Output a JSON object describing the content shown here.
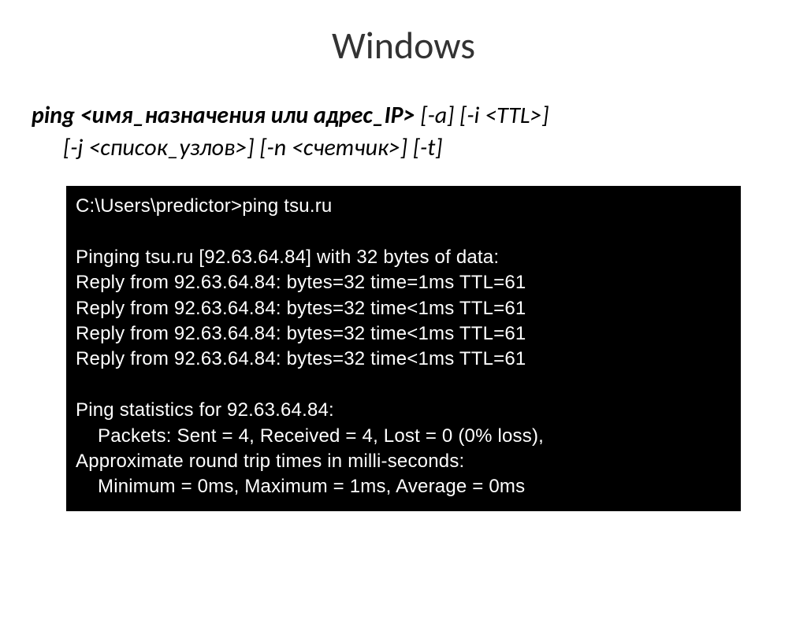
{
  "title": "Windows",
  "syntax": {
    "line1_bold": "ping <имя_назначения или адрес_IP>",
    "line1_rest": " [-a] [-i <TTL>]",
    "line2": "[-j <список_узлов>] [-n <счетчик>] [-t]"
  },
  "terminal": {
    "prompt": "C:\\Users\\predictor>ping tsu.ru",
    "header": "Pinging tsu.ru [92.63.64.84] with 32 bytes of data:",
    "replies": [
      "Reply from 92.63.64.84: bytes=32 time=1ms TTL=61",
      "Reply from 92.63.64.84: bytes=32 time<1ms TTL=61",
      "Reply from 92.63.64.84: bytes=32 time<1ms TTL=61",
      "Reply from 92.63.64.84: bytes=32 time<1ms TTL=61"
    ],
    "stats_header": "Ping statistics for 92.63.64.84:",
    "packets": "Packets: Sent = 4, Received = 4, Lost = 0 (0% loss),",
    "rtt_header": "Approximate round trip times in milli-seconds:",
    "rtt_values": "Minimum = 0ms, Maximum = 1ms, Average = 0ms"
  }
}
